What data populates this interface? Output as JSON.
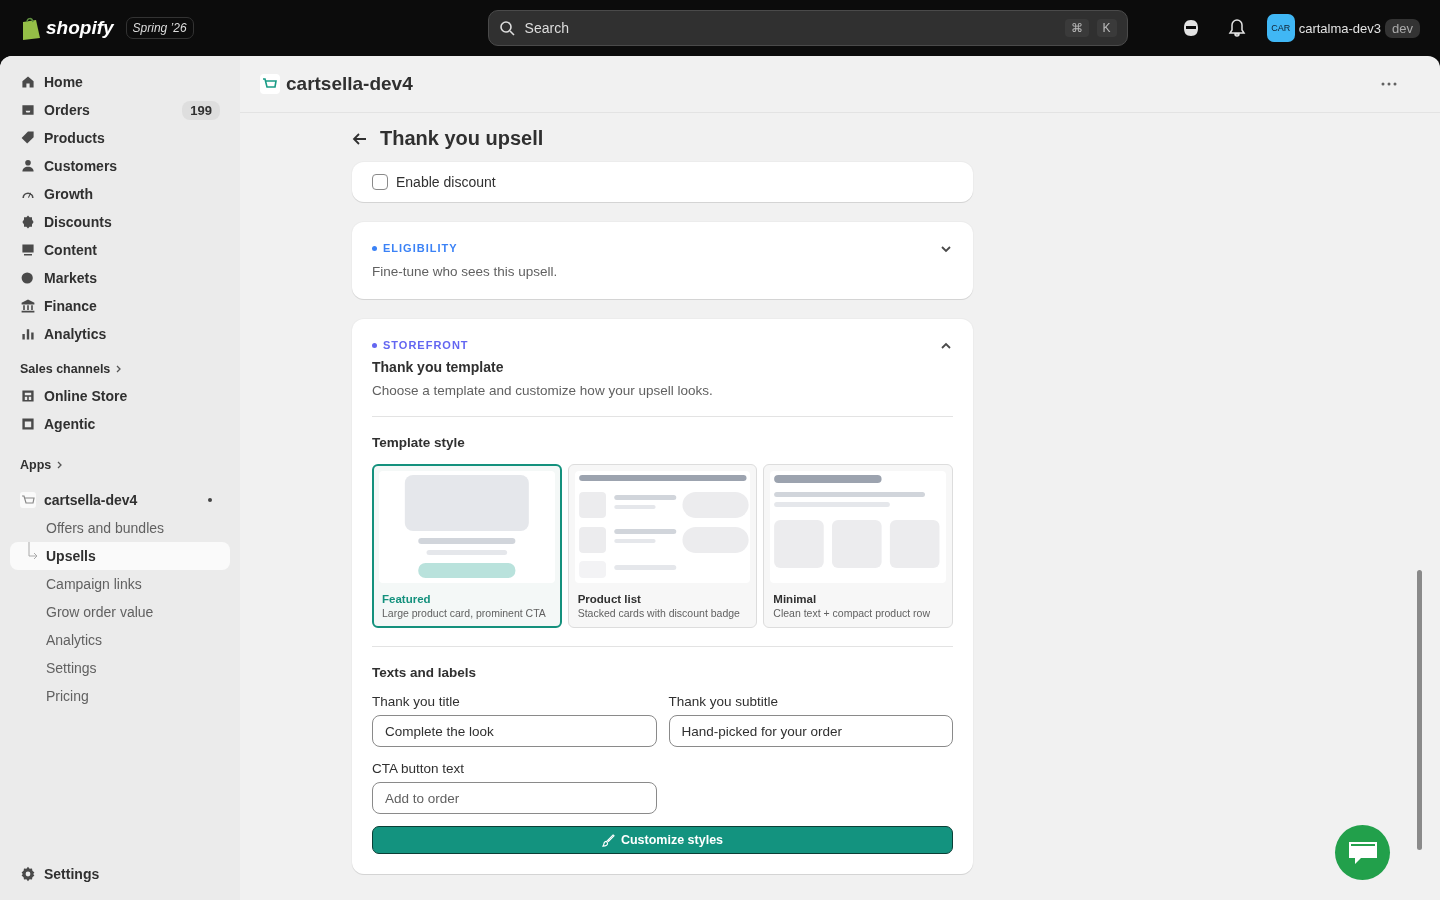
{
  "topbar": {
    "brand": "shopify",
    "edition": "Spring ’26",
    "search": {
      "placeholder": "Search",
      "keys": [
        "⌘",
        "K"
      ]
    },
    "store": {
      "avatar": "CAR",
      "name": "cartalma-dev3",
      "badge": "dev"
    }
  },
  "sidebar": {
    "items": [
      {
        "label": "Home",
        "selected": false
      },
      {
        "label": "Orders",
        "badge": "199",
        "selected": false
      },
      {
        "label": "Products",
        "selected": false
      },
      {
        "label": "Customers",
        "selected": false
      },
      {
        "label": "Growth",
        "selected": false
      },
      {
        "label": "Discounts",
        "selected": false
      },
      {
        "label": "Content",
        "selected": false
      },
      {
        "label": "Markets",
        "selected": false
      },
      {
        "label": "Finance",
        "selected": false
      },
      {
        "label": "Analytics",
        "selected": false
      }
    ],
    "sales_channels": {
      "heading": "Sales channels",
      "items": [
        {
          "label": "Online Store",
          "selected": false
        },
        {
          "label": "Agentic",
          "selected": false
        }
      ]
    },
    "apps": {
      "heading": "Apps"
    },
    "app": {
      "name": "cartsella-dev4",
      "children": [
        {
          "label": "Offers and bundles",
          "selected": false
        },
        {
          "label": "Upsells",
          "selected": true
        },
        {
          "label": "Campaign links",
          "selected": false
        },
        {
          "label": "Grow order value",
          "selected": false
        },
        {
          "label": "Analytics",
          "selected": false
        },
        {
          "label": "Settings",
          "selected": false
        },
        {
          "label": "Pricing",
          "selected": false
        }
      ]
    },
    "footer": {
      "label": "Settings"
    }
  },
  "app_header": {
    "title": "cartsella-dev4"
  },
  "page_title": "Thank you upsell",
  "discount_card": {
    "checkbox_label": "Enable discount",
    "checked": false
  },
  "eligibility": {
    "eyebrow": "ELIGIBILITY",
    "color": "#3b82f6",
    "description": "Fine-tune who sees this upsell.",
    "expanded": false
  },
  "storefront": {
    "eyebrow": "STOREFRONT",
    "color": "#6366f1",
    "title": "Thank you template",
    "description": "Choose a template and customize how your upsell looks.",
    "expanded": true,
    "template_heading": "Template style",
    "templates": [
      {
        "kind": "featured",
        "name": "Featured",
        "description": "Large product card, prominent CTA",
        "selected": true
      },
      {
        "kind": "list",
        "name": "Product list",
        "description": "Stacked cards with discount badge",
        "selected": false
      },
      {
        "kind": "minimal",
        "name": "Minimal",
        "description": "Clean text + compact product row",
        "selected": false
      }
    ],
    "texts_heading": "Texts and labels",
    "fields": [
      {
        "label": "Thank you title",
        "value": "Complete the look"
      },
      {
        "label": "Thank you subtitle",
        "value": "Hand-picked for your order"
      },
      {
        "label": "CTA button text",
        "placeholder": "Add to order"
      }
    ],
    "button": "Customize styles"
  }
}
